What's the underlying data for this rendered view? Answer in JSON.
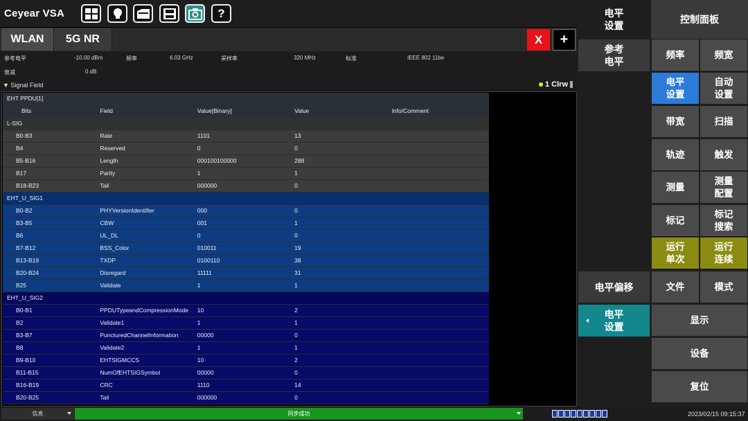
{
  "app": {
    "brand": "Ceyear VSA"
  },
  "toolbar": {
    "icons": [
      "windows-icon",
      "lightbulb-icon",
      "folder-icon",
      "save-icon",
      "camera-icon"
    ],
    "help_label": "?"
  },
  "tabs": [
    {
      "label": "WLAN",
      "active": true
    },
    {
      "label": "5G NR",
      "active": false
    }
  ],
  "tab_actions": {
    "close_label": "X",
    "add_label": "+"
  },
  "params": {
    "ref_level_label": "参考电平",
    "ref_level_value": "-10.00 dBm",
    "freq_label": "频率",
    "freq_value": "6.03 GHz",
    "sample_rate_label": "采样率",
    "sample_rate_value": "320 MHz",
    "standard_label": "标准",
    "standard_value": "IEEE 802 11be",
    "atten_label": "衰减",
    "atten_value": "0 dB"
  },
  "signal_field": {
    "title": "▼ Signal Field",
    "trace_label": "1 Clrw"
  },
  "table": {
    "title": "EHT PPDU[1]",
    "columns": [
      "Bits",
      "Field",
      "Value[Binary]",
      "Value",
      "Info/Comment"
    ],
    "sections": [
      {
        "name": "L-SIG",
        "rows": [
          [
            "B0-B3",
            "Rate",
            "1101",
            "13",
            ""
          ],
          [
            "B4",
            "Reserved",
            "0",
            "0",
            ""
          ],
          [
            "B5-B16",
            "Length",
            "000100100000",
            "288",
            ""
          ],
          [
            "B17",
            "Parity",
            "1",
            "1",
            ""
          ],
          [
            "B18-B23",
            "Tail",
            "000000",
            "0",
            ""
          ]
        ]
      },
      {
        "name": "EHT_U_SIG1",
        "rows": [
          [
            "B0-B2",
            "PHYVersionIdentifier",
            "000",
            "0",
            ""
          ],
          [
            "B3-B5",
            "CBW",
            "001",
            "1",
            ""
          ],
          [
            "B6",
            "UL_DL",
            "0",
            "0",
            ""
          ],
          [
            "B7-B12",
            "BSS_Color",
            "010011",
            "19",
            ""
          ],
          [
            "B13-B19",
            "TXDP",
            "0100110",
            "38",
            ""
          ],
          [
            "B20-B24",
            "Disregard",
            "11111",
            "31",
            ""
          ],
          [
            "B25",
            "Validate",
            "1",
            "1",
            ""
          ]
        ]
      },
      {
        "name": "EHT_U_SIG2",
        "rows": [
          [
            "B0-B1",
            "PPDUTypeandCompressionMode",
            "10",
            "2",
            ""
          ],
          [
            "B2",
            "Validate1",
            "1",
            "1",
            ""
          ],
          [
            "B3-B7",
            "PuncturedChannelInformation",
            "00000",
            "0",
            ""
          ],
          [
            "B8",
            "Validate2",
            "1",
            "1",
            ""
          ],
          [
            "B9-B10",
            "EHTSIGMCCS",
            "10",
            "2",
            ""
          ],
          [
            "B11-B15",
            "NumOfEHTSIGSymbol",
            "00000",
            "0",
            ""
          ],
          [
            "B16-B19",
            "CRC",
            "1110",
            "14",
            ""
          ],
          [
            "B20-B25",
            "Tail",
            "000000",
            "0",
            ""
          ]
        ]
      }
    ]
  },
  "status": {
    "info_label": "信息",
    "sync_message": "同步成功",
    "clock": "2023/02/15 09:15:37"
  },
  "submenu": {
    "level_settings_top": "电平\n设置",
    "ref_level": "参考\n电平",
    "level_offset": "电平偏移",
    "level_settings_bottom": "电平\n设置"
  },
  "control_panel": {
    "title": "控制面板",
    "buttons": [
      "频率",
      "频宽",
      "电平\n设置",
      "自动\n设置",
      "带宽",
      "扫描",
      "轨迹",
      "触发",
      "测量",
      "测量\n配置",
      "标记",
      "标记\n搜索",
      "运行\n单次",
      "运行\n连续",
      "文件",
      "模式"
    ],
    "display": "显示",
    "device": "设备",
    "reset": "复位"
  },
  "colors": {
    "active_blue": "#2b7bd8",
    "run_olive": "#8b8b12",
    "teal": "#12878c",
    "close_red": "#e8131a",
    "sync_green": "#18951e",
    "lsig_bg": "#3c3c3c",
    "usig1_bg": "#0d3c82",
    "usig2_bg": "#070a68"
  }
}
